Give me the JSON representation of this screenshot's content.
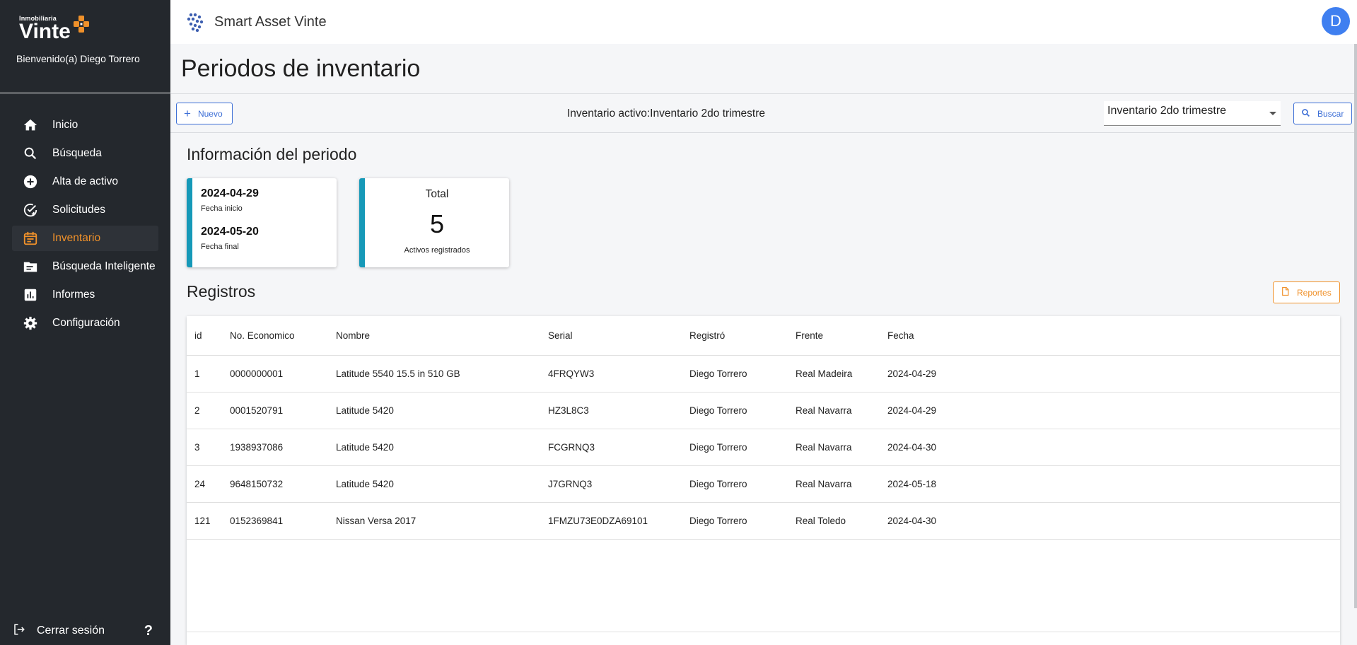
{
  "sidebar": {
    "logo_small": "Inmobiliaria",
    "logo_big": "Vinte",
    "welcome": "Bienvenido(a) Diego Torrero",
    "items": [
      {
        "label": "Inicio",
        "icon": "home-icon"
      },
      {
        "label": "Búsqueda",
        "icon": "search-icon"
      },
      {
        "label": "Alta de activo",
        "icon": "add-circle-icon"
      },
      {
        "label": "Solicitudes",
        "icon": "check-circle-icon"
      },
      {
        "label": "Inventario",
        "icon": "calendar-icon"
      },
      {
        "label": "Búsqueda Inteligente",
        "icon": "folder-icon"
      },
      {
        "label": "Informes",
        "icon": "bar-chart-icon"
      },
      {
        "label": "Configuración",
        "icon": "gear-icon"
      }
    ],
    "logout_label": "Cerrar sesión",
    "help_label": "?"
  },
  "header": {
    "app_title": "Smart Asset Vinte",
    "avatar_letter": "D"
  },
  "page": {
    "title": "Periodos de inventario"
  },
  "toolbar": {
    "new_label": "Nuevo",
    "active_inventory": "Inventario activo:Inventario 2do trimestre",
    "select_value": "Inventario 2do trimestre",
    "search_label": "Buscar"
  },
  "info": {
    "title": "Información del periodo",
    "start_date": "2024-04-29",
    "start_label": "Fecha inicio",
    "end_date": "2024-05-20",
    "end_label": "Fecha final",
    "total_label": "Total",
    "total_value": "5",
    "total_sub": "Activos registrados"
  },
  "records": {
    "title": "Registros",
    "reports_label": "Reportes",
    "columns": [
      "id",
      "No. Economico",
      "Nombre",
      "Serial",
      "Registró",
      "Frente",
      "Fecha"
    ],
    "rows": [
      [
        "1",
        "0000000001",
        "Latitude 5540 15.5 in 510 GB",
        "4FRQYW3",
        "Diego Torrero",
        "Real Madeira",
        "2024-04-29"
      ],
      [
        "2",
        "0001520791",
        "Latitude 5420",
        "HZ3L8C3",
        "Diego Torrero",
        "Real Navarra",
        "2024-04-29"
      ],
      [
        "3",
        "1938937086",
        "Latitude 5420",
        "FCGRNQ3",
        "Diego Torrero",
        "Real Navarra",
        "2024-04-30"
      ],
      [
        "24",
        "9648150732",
        "Latitude 5420",
        "J7GRNQ3",
        "Diego Torrero",
        "Real Navarra",
        "2024-05-18"
      ],
      [
        "121",
        "0152369841",
        "Nissan Versa 2017",
        "1FMZU73E0DZA69101",
        "Diego Torrero",
        "Real Toledo",
        "2024-04-30"
      ]
    ]
  },
  "colors": {
    "sidebar_bg": "#24282d",
    "accent_orange": "#f0912a",
    "primary_blue": "#3d6fd6",
    "card_accent": "#1699b8"
  }
}
